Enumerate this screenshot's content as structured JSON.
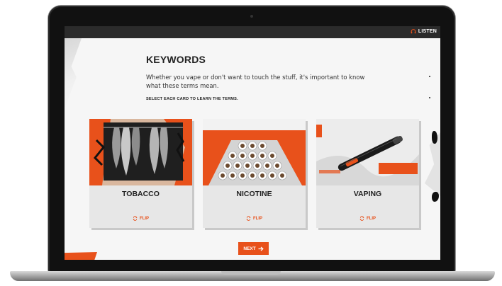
{
  "header": {
    "listen_label": "LISTEN",
    "listen_icon": "headphones-icon"
  },
  "main": {
    "title": "KEYWORDS",
    "intro": "Whether you vape or don't want to touch the stuff,  it's important to know what these terms mean.",
    "instruction": "SELECT EACH CARD TO LEARN THE TERMS."
  },
  "cards": [
    {
      "title": "TOBACCO",
      "flip_label": "FLIP",
      "flip_icon": "flip-icon"
    },
    {
      "title": "NICOTINE",
      "flip_label": "FLIP",
      "flip_icon": "flip-icon"
    },
    {
      "title": "VAPING",
      "flip_label": "FLIP",
      "flip_icon": "flip-icon"
    }
  ],
  "footer": {
    "next_label": "NEXT",
    "next_icon": "arrow-right-icon"
  },
  "colors": {
    "accent": "#e8511b",
    "topbar": "#2b2b2b",
    "card_bg": "#e7e7e7"
  }
}
